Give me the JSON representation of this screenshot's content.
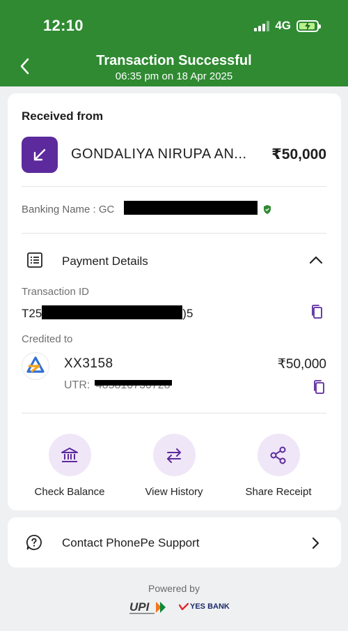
{
  "status_bar": {
    "time": "12:10",
    "network": "4G"
  },
  "header": {
    "title": "Transaction Successful",
    "subtitle": "06:35 pm on 18 Apr 2025",
    "background": "#2f8a32"
  },
  "received": {
    "section_title": "Received from",
    "payer_name": "GONDALIYA NIRUPA  AN...",
    "amount": "₹50,000",
    "banking_name_label": "Banking Name  :  GC",
    "icon": "incoming-arrow-icon"
  },
  "payment_details": {
    "title": "Payment Details",
    "transaction_id_label": "Transaction ID",
    "transaction_id_prefix": "T25",
    "transaction_id_suffix": ")5",
    "credited_to_label": "Credited to",
    "account": "XX3158",
    "amount": "₹50,000",
    "utr_label": "UTR:",
    "utr_visible": "485810730728"
  },
  "actions": [
    {
      "label": "Check Balance",
      "icon": "bank-icon"
    },
    {
      "label": "View History",
      "icon": "swap-arrows-icon"
    },
    {
      "label": "Share Receipt",
      "icon": "share-icon"
    }
  ],
  "support": {
    "label": "Contact PhonePe Support",
    "icon": "help-circle-icon"
  },
  "footer": {
    "powered_by": "Powered by",
    "bank": "YES BANK",
    "upi": "UPI"
  },
  "colors": {
    "accent_purple": "#5c2a9d",
    "action_bg": "#efe6f7",
    "verified_green": "#2f8a32"
  }
}
